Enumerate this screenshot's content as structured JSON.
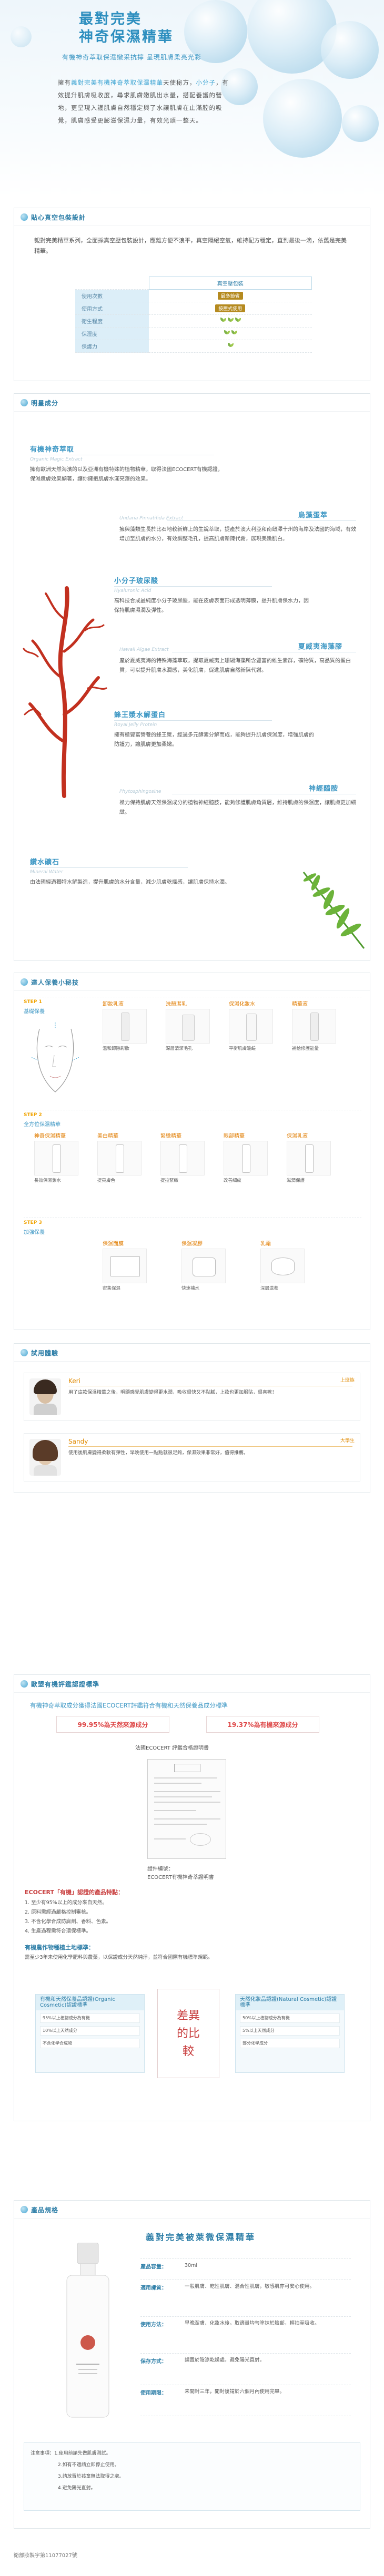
{
  "hero": {
    "title_line1": "最對完美",
    "title_line2": "神奇保濕精華",
    "subtitle": "有機神奇萃取保濕嫩采抗擰 呈現肌膚柔亮光彩",
    "body_prefix": "擁有",
    "body_highlight1": "義對完美有機神奇萃取保濕精華",
    "body_mid": "天使秘方，",
    "body_highlight2": "小分子",
    "body_rest": "，有效提升肌膚吸收度，尋求肌膚嫩肌出水量，搭配養護的營地，更呈現入護肌膚自然穩定與了水讓肌膚在止滿腔的吸覺，肌膚感受更膨滋保濕力量，有效光頭一整天。"
  },
  "section1": {
    "title": "貼心真空包裝設計",
    "text": "親對完美精華系列，全面採真空壓包裝設計，應離方便不浪平，真空隔絕空氣，維持配方穩定，直到最後一滴，依舊是完美精華。",
    "table_header": "真空壓包裝",
    "rows": [
      {
        "label": "使用次數",
        "value": "最多節省"
      },
      {
        "label": "使用方式",
        "value": "按壓式使用"
      },
      {
        "label": "衛生程度",
        "value": "★"
      },
      {
        "label": "保溼度",
        "value": "★"
      },
      {
        "label": "保護力",
        "value": "★"
      }
    ]
  },
  "section2": {
    "title": "明星成分",
    "ingredients": [
      {
        "name": "有機神奇萃取",
        "latin": "Organic Magic Extract",
        "desc": "擁有歐洲天然海濱的以及亞洲有機特殊的植物精華，取得法國ECOCERT有機認證，保濕嫩膚效果顯著，讓你擁抱肌膚水漾亮澤的效果。"
      },
      {
        "name": "烏藻蛋萃",
        "latin": "Undaria Pinnatifida Extract",
        "desc": "擁與藻類生長於比石地較新鮮上的生說萃取，提產於澳大利亞和南紐澤十州的海岸及法國的海域，有效增加至肌膚的水分，有效調整毛孔，提高肌膚新陳代謝，展現美嫩肌白。"
      },
      {
        "name": "小分子玻尿酸",
        "latin": "Hyaluronic Acid",
        "desc": "高科技合成最純度小分子玻尿酸，能在皮膚表面形成透明薄膜，提升肌膚保水力，因保持肌膚濕潤及彈性。"
      },
      {
        "name": "夏威夷海藻膠",
        "latin": "Hawaii Algae Extract",
        "desc": "產於夏威夷海的特殊海藻萃取，提取夏威夷上珊瑚海藻所含豐富的維生素群，礦物質，高品質的蛋白質，可以提升肌膚水潤感，美化肌膚，促進肌膚自然新陳代謝。"
      },
      {
        "name": "蜂王漿水解蛋白",
        "latin": "Royal Jelly Protein",
        "desc": "擁有極豐富營養的蜂王漿，經過多元酵素分解而成，能夠提升肌膚保濕度，增強肌膚的防護力，讓肌膚更加柔嫩。"
      },
      {
        "name": "神經醯胺",
        "latin": "Phytosphingosine",
        "desc": "極力保持肌膚天然保濕成分的植物神經醯胺，能夠修護肌膚角質層，維持肌膚的保濕度，讓肌膚更加細緻。"
      },
      {
        "name": "鑽水礦石",
        "latin": "Mineral Water",
        "desc": "由法國經過獨特水解製造，提升肌膚的水分含量，減少肌膚乾燥感，讓肌膚保持水潤。"
      }
    ]
  },
  "section3": {
    "title": "達人保養小秘技",
    "steps": [
      {
        "tag": "STEP 1",
        "name": "基礎保養",
        "items": [
          {
            "name": "卸妝乳液",
            "desc": "溫和卸除彩妝"
          },
          {
            "name": "洗顏潔乳",
            "desc": "深層清潔毛孔"
          },
          {
            "name": "保濕化妝水",
            "desc": "平衡肌膚酸鹼"
          },
          {
            "name": "精華液",
            "desc": "補給修護能量"
          }
        ]
      },
      {
        "tag": "STEP 2",
        "name": "全方位保濕精華",
        "items": [
          {
            "name": "神奇保濕精華",
            "desc": "長效保濕鎖水"
          },
          {
            "name": "美白精華",
            "desc": "提亮膚色"
          },
          {
            "name": "緊緻精華",
            "desc": "提拉緊緻"
          },
          {
            "name": "眼部精華",
            "desc": "改善細紋"
          },
          {
            "name": "保濕乳液",
            "desc": "滋潤保護"
          }
        ]
      },
      {
        "tag": "STEP 3",
        "name": "加強保養",
        "items": [
          {
            "name": "保濕面膜",
            "desc": "密集保濕"
          },
          {
            "name": "保濕凝膠",
            "desc": "快速補水"
          },
          {
            "name": "乳霜",
            "desc": "深層滋養"
          }
        ]
      }
    ]
  },
  "section4": {
    "title": "試用體驗",
    "reviews": [
      {
        "name": "Keri",
        "tag": "上班族",
        "text": "用了這款保濕精華之後，明顯感覺肌膚變得更水潤，吸收很快又不黏膩，上妝也更加服貼，很喜歡！"
      },
      {
        "name": "Sandy",
        "tag": "大學生",
        "text": "使用後肌膚變得柔軟有彈性，早晚使用一點點就很足夠，保濕效果非常好，值得推薦。"
      }
    ]
  },
  "section5": {
    "title": "歐盟有機評鑑認證標準",
    "lead": "有機神奇萃取成分獲得法國ECOCERT評鑑符合有機和天然保養品成分標準",
    "box_left": "99.95%為天然來源成分",
    "box_right": "19.37%為有機來源成分",
    "doc_caption": "法國ECOCERT 評鑑合格證明書",
    "cert_note": "證件編號：",
    "cert_label": "ECOCERT有機神奇萃證明書",
    "eco_heading": "ECOCERT「有機」認證的產品特點：",
    "eco_items": [
      "1. 至少有95%以上的成分來自天然。",
      "2. 原料需經過嚴格控制審核。",
      "3. 不含化學合成防腐劑、香料、色素。",
      "4. 生產過程需符合環保標準。"
    ],
    "organic_heading": "有機農作物種植土地標準：",
    "organic_text": "需至少3年未使用化學肥料與農藥，以保證成分天然純淨，並符合國際有機標準規範。",
    "cmp_left_title": "有機和天然保養品認證(Organic Cosmetic)認證標準",
    "cmp_left_rows": [
      "95%以上植物成分為有機",
      "10%以上天然成分",
      "不含化學合成物"
    ],
    "diff_label": "差異的比較",
    "cmp_right_title": "天然化妝品認證(Natural Cosmetic)認證標準",
    "cmp_right_rows": [
      "50%以上植物成分為有機",
      "5%以上天然成分",
      "部分化學成分"
    ]
  },
  "section6": {
    "title": "產品規格",
    "product_title": "義對完美被萊微保濕精華",
    "rows": [
      {
        "label": "產品容量：",
        "value": "30ml"
      },
      {
        "label": "適用膚質：",
        "value": "一般肌膚、乾性肌膚、混合性肌膚，敏感肌亦可安心使用。"
      },
      {
        "label": "使用方法：",
        "value": "早晚潔膚、化妝水後，取適量均勻塗抹於臉部，輕拍至吸收。"
      },
      {
        "label": "保存方式：",
        "value": "請置於陰涼乾燥處，避免陽光直射。"
      },
      {
        "label": "使用期限：",
        "value": "未開封三年，開封後請於六個月內使用完畢。"
      }
    ],
    "notes": [
      "注意事項：1.使用前請先做肌膚測試。",
      "2.如有不適請立即停止使用。",
      "3.請放置於孩童無法取得之處。",
      "4.避免陽光直射。"
    ],
    "cosmetic_code": "衛部妝製字第11077027號"
  }
}
